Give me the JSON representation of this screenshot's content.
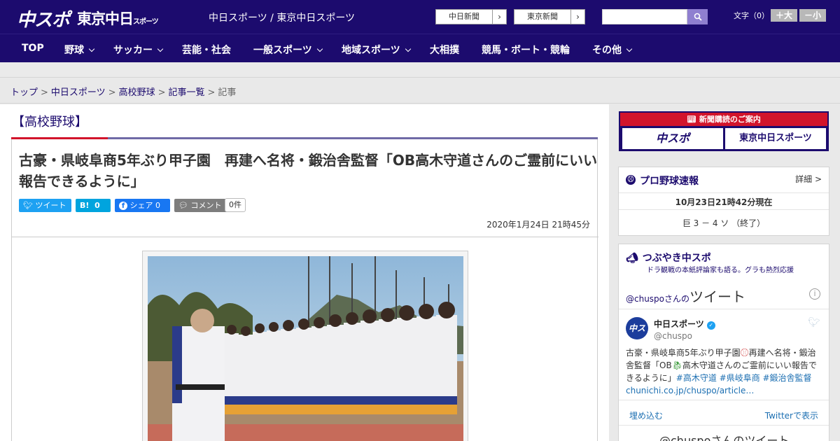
{
  "header": {
    "logo_chuspo": "中スポ",
    "logo_tokyo": "東京中日",
    "logo_tokyo_sub": "スポーツ",
    "site_title": "中日スポーツ / 東京中日スポーツ",
    "ext_links": [
      "中日新聞",
      "東京新聞"
    ],
    "search_placeholder": "",
    "font_size_label": "文字（0）",
    "font_bigger": "＋大",
    "font_smaller": "－小"
  },
  "nav": {
    "items": [
      {
        "label": "TOP",
        "has_menu": false
      },
      {
        "label": "野球",
        "has_menu": true
      },
      {
        "label": "サッカー",
        "has_menu": true
      },
      {
        "label": "芸能・社会",
        "has_menu": false
      },
      {
        "label": "一般スポーツ",
        "has_menu": true
      },
      {
        "label": "地域スポーツ",
        "has_menu": true
      },
      {
        "label": "大相撲",
        "has_menu": false
      },
      {
        "label": "競馬・ボート・競輪",
        "has_menu": false
      },
      {
        "label": "その他",
        "has_menu": true
      }
    ]
  },
  "breadcrumb": {
    "items": [
      "トップ",
      "中日スポーツ",
      "高校野球",
      "記事一覧",
      "記事"
    ]
  },
  "article": {
    "section": "【高校野球】",
    "headline": "古豪・県岐阜商5年ぶり甲子園　再建へ名将・鍛治舎監督「OB高木守道さんのご霊前にいい報告できるように」",
    "share": {
      "tweet": "ツイート",
      "hatena": "B!",
      "hatena_count": "0",
      "facebook": "シェア",
      "facebook_count": "0",
      "comment": "コメント",
      "comment_count": "0件"
    },
    "published": "2020年1月24日 21時45分"
  },
  "sidebar": {
    "subscribe_header": "新聞購読のご案内",
    "subscribe_options": [
      "中スポ",
      "東京中日スポーツ"
    ],
    "score_panel": {
      "title": "プロ野球速報",
      "detail_link": "詳細 >",
      "updated": "10月23日21時42分現在",
      "game": "巨 3 － 4 ソ （終了）"
    },
    "tweets_panel": {
      "title": "つぶやき中スポ",
      "subtitle": "ドラ観戦の本紙評論家も語る。グラも熱烈応援",
      "header_prefix": "@chuspoさんの",
      "header_main": "ツイート",
      "account_name": "中日スポーツ",
      "account_handle": "@chuspo",
      "tweet_text": "古豪・県岐阜商5年ぶり甲子園",
      "tweet_text_2": "再建へ名将・鍛治舎監督「OB",
      "tweet_text_3": "高木守道さんのご霊前にいい報告できるように」",
      "hashtags": "#高木守道 #県岐阜商 #鍛治舎監督",
      "link": "chunichi.co.jp/chuspo/article…",
      "embed": "埋め込む",
      "view_on_twitter": "Twitterで表示",
      "more": "@chuspoさんのツイート"
    }
  },
  "colors": {
    "brand_navy": "#1c0b6e",
    "accent_red": "#d2142b",
    "twitter_blue": "#1da1f2",
    "facebook_blue": "#1877f2",
    "hatena_blue": "#00a4de"
  }
}
